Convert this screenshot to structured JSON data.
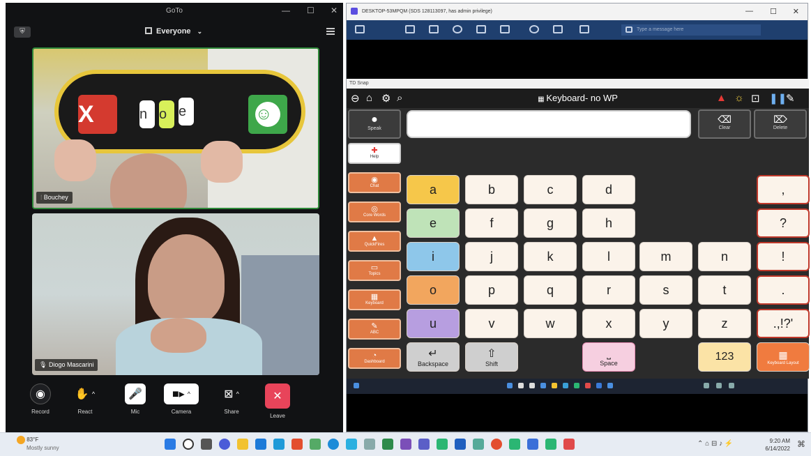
{
  "zoom": {
    "title": "GoTo",
    "view_label": "Everyone",
    "participants": [
      {
        "name": "Bouchey"
      },
      {
        "name": "Diogo Mascarini"
      }
    ],
    "controls": [
      {
        "label": "Record",
        "icon": "record-icon"
      },
      {
        "label": "React",
        "icon": "hand-icon"
      },
      {
        "label": "Mic",
        "icon": "microphone-icon"
      },
      {
        "label": "Camera",
        "icon": "camera-icon"
      },
      {
        "label": "Share",
        "icon": "share-icon"
      },
      {
        "label": "Leave",
        "icon": "close-icon"
      }
    ],
    "board_cards": [
      "X",
      "n",
      "o",
      "e"
    ]
  },
  "remote": {
    "title": "DESKTOP-53MPQM (SDS 128113097, has admin privilege)",
    "message_placeholder": "Type a message here"
  },
  "td": {
    "window_title": "TD Snap",
    "page_title": "Keyboard- no WP",
    "speak_label": "Speak",
    "clear_label": "Clear",
    "delete_label": "Delete",
    "sidebar": [
      {
        "label": "Help",
        "icon": "plus-icon"
      },
      {
        "label": "Chat",
        "icon": "chat-icon"
      },
      {
        "label": "Core Words",
        "icon": "core-icon"
      },
      {
        "label": "QuickFires",
        "icon": "fire-icon"
      },
      {
        "label": "Topics",
        "icon": "topics-icon"
      },
      {
        "label": "Keyboard",
        "icon": "keyboard-icon"
      },
      {
        "label": "ABC",
        "icon": "abc-icon"
      },
      {
        "label": "Dashboard",
        "icon": "dashboard-icon"
      }
    ],
    "keys": {
      "row1": [
        "a",
        "b",
        "c",
        "d",
        ","
      ],
      "row2": [
        "e",
        "f",
        "g",
        "h",
        "?"
      ],
      "row3": [
        "i",
        "j",
        "k",
        "l",
        "m",
        "n",
        "!"
      ],
      "row4": [
        "o",
        "p",
        "q",
        "r",
        "s",
        "t",
        "."
      ],
      "row5": [
        "u",
        "v",
        "w",
        "x",
        "y",
        "z",
        ".,!?'"
      ],
      "backspace": "Backspace",
      "shift": "Shift",
      "space": "Space",
      "numbers": "123",
      "keyboard_layout": "Keyboard Layout"
    }
  },
  "taskbar": {
    "weather_temp": "83°F",
    "weather_desc": "Mostly sunny",
    "time": "9:20 AM",
    "date": "6/14/2022"
  },
  "colors": {
    "key_a": "#f6c74a",
    "key_e": "#bfe3b8",
    "key_i": "#8ec7ea",
    "key_o": "#f2a65e",
    "key_u": "#b79ee0",
    "key_default": "#fbf3ea",
    "punct_border": "#c0392b",
    "sidebar_tile": "#e07a46",
    "leave_button": "#e8445a"
  }
}
